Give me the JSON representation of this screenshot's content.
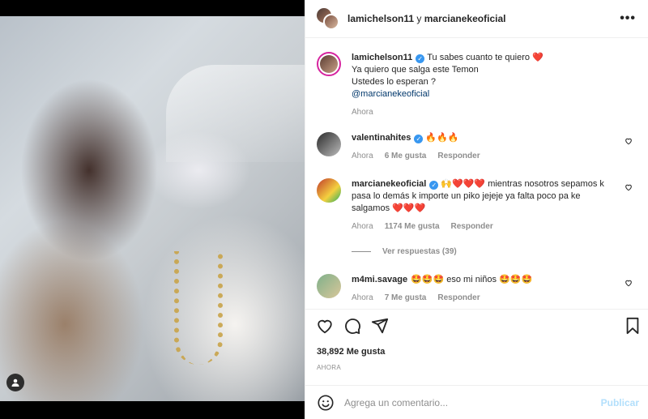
{
  "header": {
    "user1": "lamichelson11",
    "separator": "y",
    "user2": "marcianekeoficial",
    "more_icon": "more-horizontal-icon"
  },
  "caption": {
    "user": "lamichelson11",
    "line1": "Tu sabes cuanto te quiero",
    "line1_emoji": "❤️",
    "line2": "Ya quiero que salga este Temon",
    "line3": "Ustedes lo esperan ?",
    "mention": "@marcianekeoficial",
    "time": "Ahora"
  },
  "comments": [
    {
      "user": "valentinahites",
      "text": "🔥🔥🔥",
      "time": "Ahora",
      "likes": "6 Me gusta",
      "reply": "Responder"
    },
    {
      "user": "marcianekeoficial",
      "emoji_prefix": "🙌❤️❤️❤️",
      "text": "mientras nosotros sepamos k pasa lo demás k importe un piko jejeje ya falta poco pa ke salgamos",
      "emoji_suffix": "❤️❤️❤️",
      "time": "Ahora",
      "likes": "1174 Me gusta",
      "reply": "Responder",
      "view_replies": "Ver respuestas (39)"
    },
    {
      "user": "m4mi.savage",
      "emoji_prefix": "🤩🤩🤩",
      "text": "eso mi niños",
      "emoji_suffix": "🤩🤩🤩",
      "time": "Ahora",
      "likes": "7 Me gusta",
      "reply": "Responder"
    }
  ],
  "post": {
    "likes": "38,892 Me gusta",
    "time": "AHORA"
  },
  "comment_box": {
    "placeholder": "Agrega un comentario...",
    "publish": "Publicar"
  },
  "colors": {
    "verified": "#3897f0",
    "like_red": "#ed4956",
    "link": "#00376b",
    "publish_disabled": "#b2dffc",
    "muted": "#8e8e8e"
  }
}
